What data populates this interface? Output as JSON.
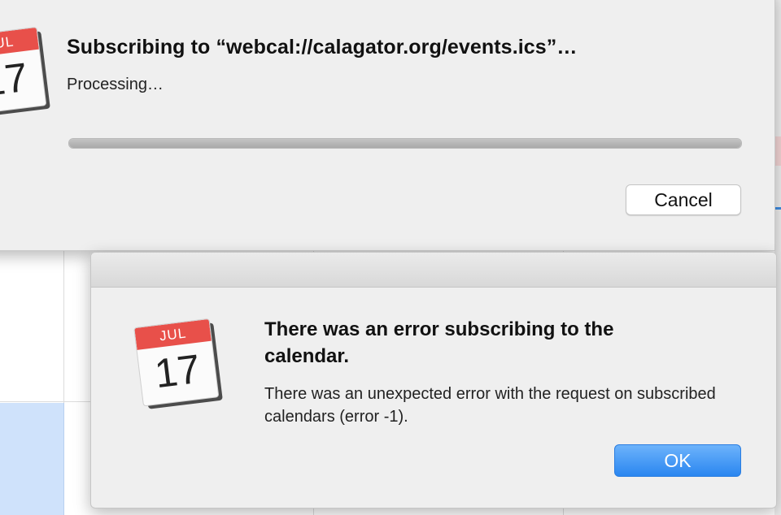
{
  "subscribe_sheet": {
    "title": "Subscribing to “webcal://calagator.org/events.ics”…",
    "status": "Processing…",
    "progress_fraction": 1.0,
    "cancel_label": "Cancel",
    "icon": "calendar-icon"
  },
  "error_alert": {
    "heading": "There was an error subscribing to the calendar.",
    "message": "There was an unexpected error with the request on subscribed calendars (error -1).",
    "ok_label": "OK",
    "icon_month": "JUL",
    "icon_day": "17",
    "icon": "calendar-icon"
  },
  "colors": {
    "accent": "#2a86f0",
    "calendar_red": "#e8504a"
  }
}
